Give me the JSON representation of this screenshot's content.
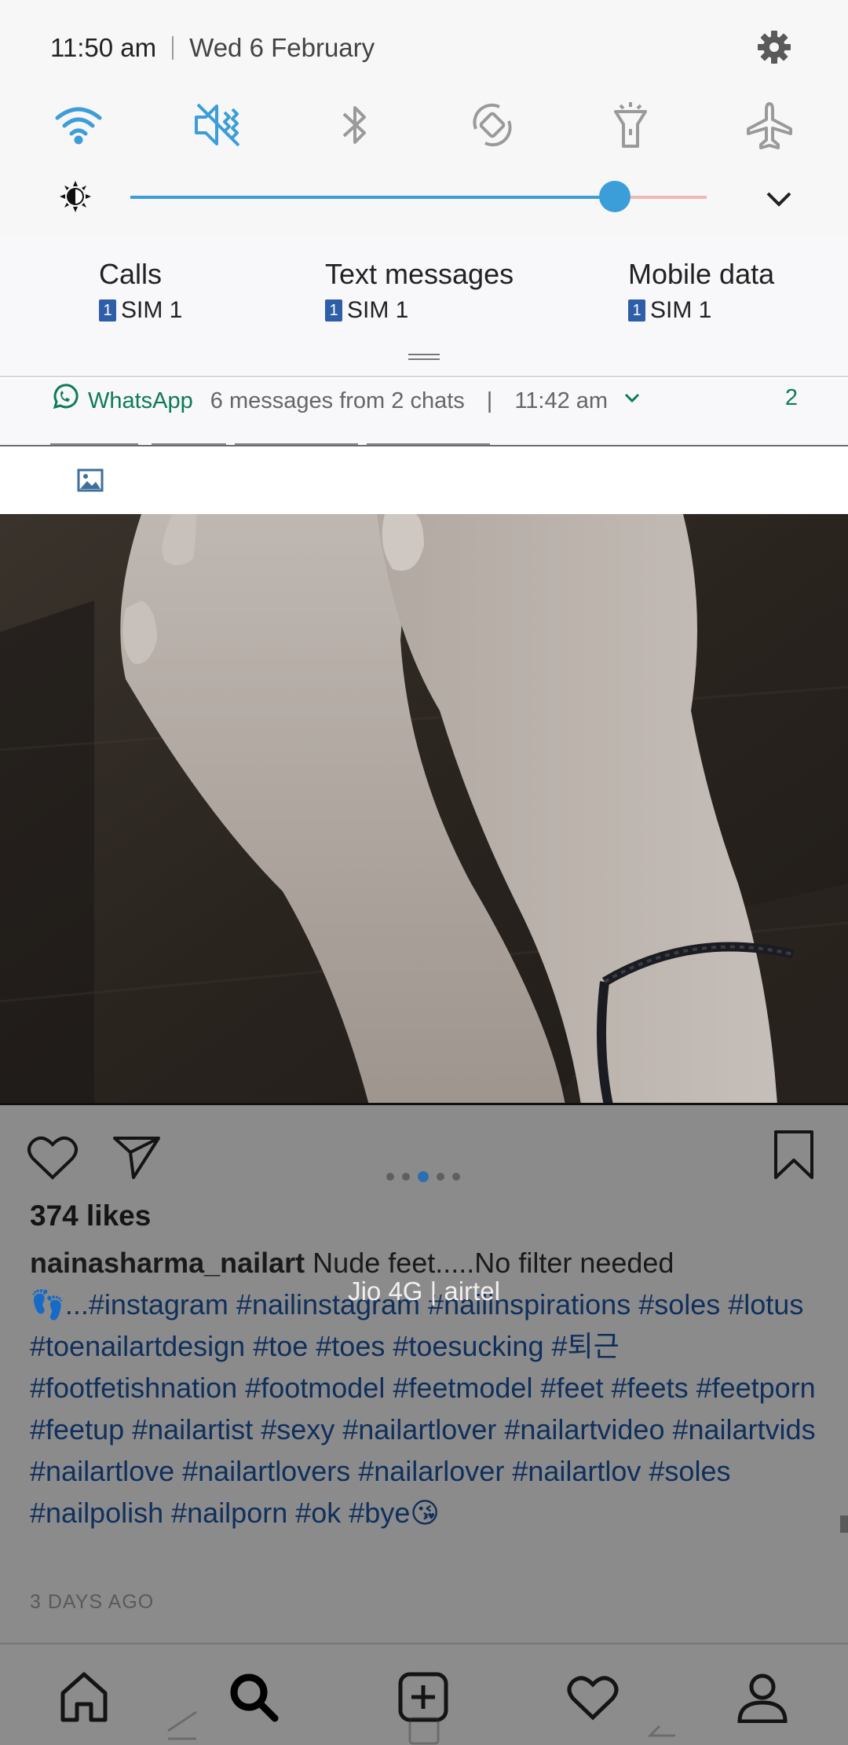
{
  "status": {
    "time": "11:50 am",
    "date": "Wed 6 February"
  },
  "quick_settings": [
    "wifi-icon",
    "mute-vibrate-icon",
    "bluetooth-icon",
    "auto-rotate-icon",
    "flashlight-icon",
    "airplane-mode-icon"
  ],
  "brightness": {
    "level": 0.84
  },
  "sim_prefs": [
    {
      "label": "Calls",
      "sim_number": "1",
      "sim": "SIM 1"
    },
    {
      "label": "Text messages",
      "sim_number": "1",
      "sim": "SIM 1"
    },
    {
      "label": "Mobile data",
      "sim_number": "1",
      "sim": "SIM 1"
    }
  ],
  "notification": {
    "app": "WhatsApp",
    "summary": "6 messages from 2 chats",
    "separator": "|",
    "time": "11:42 am",
    "count": "2"
  },
  "post": {
    "carousel": {
      "total": 5,
      "active": 3
    },
    "likes": "374 likes",
    "username": "nainasharma_nailart",
    "caption_text": "Nude feet.....No filter needed",
    "caption_tags": "👣...#instagram #nailinstagram #nailinspirations #soles #lotus #toenailartdesign #toe #toes #toesucking #퇴근 #footfetishnation #footmodel #feetmodel #feet #feets #feetporn #feetup #nailartist #sexy #nailartlover #nailartvideo #nailartvids #nailartlove #nailartlovers #nailarlover #nailartlov #soles #nailpolish #nailporn #ok #bye😘",
    "ago": "3 DAYS AGO"
  },
  "carrier": "Jio 4G | airtel",
  "nav": [
    "home-icon",
    "search-icon",
    "new-post-icon",
    "activity-heart-icon",
    "profile-icon"
  ],
  "colors": {
    "accent": "#3c9ed9",
    "whatsapp": "#0d7a5a",
    "hashtag": "#0f2f5c"
  }
}
